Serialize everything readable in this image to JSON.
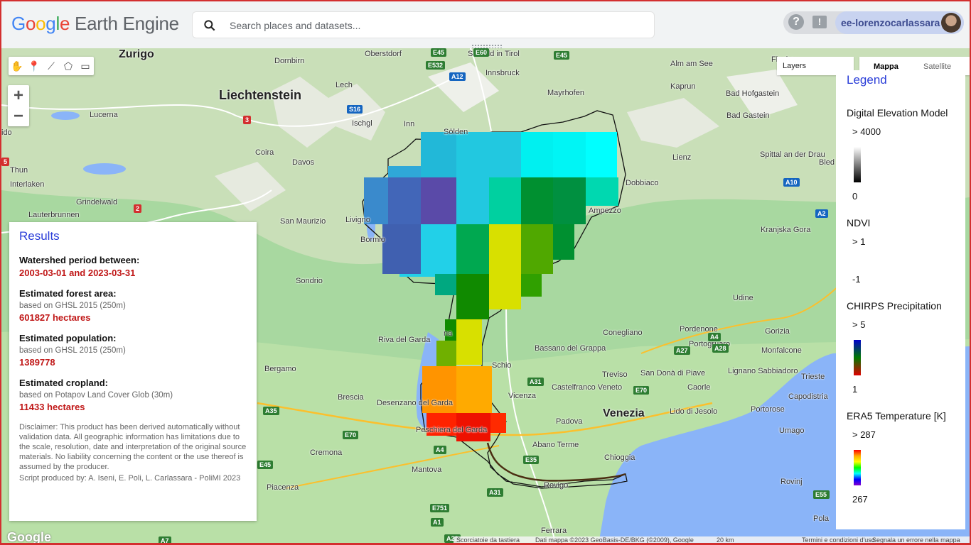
{
  "header": {
    "logo_letters": [
      "G",
      "o",
      "o",
      "g",
      "l",
      "e"
    ],
    "logo_suffix": " Earth Engine",
    "search_placeholder": "Search places and datasets...",
    "user": "ee-lorenzocarlassara",
    "help_icon": "?",
    "feedback_icon": "!"
  },
  "map_controls": {
    "layers_label": "Layers",
    "map_type_map": "Mappa",
    "map_type_satellite": "Satellite",
    "zoom_in": "+",
    "zoom_out": "−"
  },
  "results": {
    "title": "Results",
    "watershed_label": "Watershed period between:",
    "watershed_value": "2003-03-01 and 2023-03-31",
    "forest_label": "Estimated forest area:",
    "forest_source": "based on GHSL 2015 (250m)",
    "forest_value": "601827 hectares",
    "population_label": "Estimated population:",
    "population_source": "based on GHSL 2015 (250m)",
    "population_value": "1389778",
    "cropland_label": "Estimated cropland:",
    "cropland_source": "based on Potapov Land Cover Glob (30m)",
    "cropland_value": "11433 hectares",
    "disclaimer": "Disclaimer: This product has been derived automatically without validation data. All geographic information has limitations due to the scale, resolution, date and interpretation of the original source materials. No liability concerning the content or the use thereof is assumed by the producer.",
    "credit": "Script produced by: A. Iseni, E. Poli, L. Carlassara - PoliMI 2023"
  },
  "legend": {
    "title": "Legend",
    "items": [
      {
        "title": "Digital Elevation Model",
        "max": "> 4000",
        "min": "0",
        "colors": [
          "#ffffff",
          "#000000"
        ]
      },
      {
        "title": "NDVI",
        "max": "> 1",
        "min": "-1",
        "colors": [
          "#ffffff",
          "#ffffff"
        ]
      },
      {
        "title": "CHIRPS Precipitation",
        "max": "> 5",
        "min": "1",
        "colors": [
          "#0000cc",
          "#007a00",
          "#e00000"
        ]
      },
      {
        "title": "ERA5 Temperature [K]",
        "max": "> 287",
        "min": "267",
        "colors": [
          "#ff0000",
          "#ffaa00",
          "#ffff00",
          "#00ff00",
          "#00ffff",
          "#0000ff",
          "#8800cc"
        ]
      }
    ]
  },
  "map_labels": [
    {
      "text": "Zurigo",
      "cls": "med"
    },
    {
      "text": "Liechtenstein",
      "cls": "big"
    },
    {
      "text": "Lucerna",
      "cls": ""
    },
    {
      "text": "Coira",
      "cls": ""
    },
    {
      "text": "Davos",
      "cls": ""
    },
    {
      "text": "Thun",
      "cls": ""
    },
    {
      "text": "Interlaken",
      "cls": ""
    },
    {
      "text": "Grindelwald",
      "cls": ""
    },
    {
      "text": "Lauterbrunnen",
      "cls": ""
    },
    {
      "text": "Oberstdorf",
      "cls": ""
    },
    {
      "text": "Dornbirn",
      "cls": ""
    },
    {
      "text": "Lech",
      "cls": ""
    },
    {
      "text": "Seefeld in Tirol",
      "cls": ""
    },
    {
      "text": "Innsbruck",
      "cls": ""
    },
    {
      "text": "Mayrhofen",
      "cls": ""
    },
    {
      "text": "Ischgl",
      "cls": ""
    },
    {
      "text": "Sölden",
      "cls": ""
    },
    {
      "text": "Inn",
      "cls": ""
    },
    {
      "text": "Alm am See",
      "cls": ""
    },
    {
      "text": "Flachau",
      "cls": ""
    },
    {
      "text": "Kaprun",
      "cls": ""
    },
    {
      "text": "Bad Hofgastein",
      "cls": ""
    },
    {
      "text": "Bad Gastein",
      "cls": ""
    },
    {
      "text": "Lienz",
      "cls": ""
    },
    {
      "text": "Spittal an der Drau",
      "cls": ""
    },
    {
      "text": "Bled",
      "cls": ""
    },
    {
      "text": "Kranjska Gora",
      "cls": ""
    },
    {
      "text": "Ampezzo",
      "cls": ""
    },
    {
      "text": "Livigno",
      "cls": ""
    },
    {
      "text": "Bormio",
      "cls": ""
    },
    {
      "text": "San Maurizio",
      "cls": ""
    },
    {
      "text": "Sondrio",
      "cls": ""
    },
    {
      "text": "Riva del Garda",
      "cls": ""
    },
    {
      "text": "Udine",
      "cls": ""
    },
    {
      "text": "Gorizia",
      "cls": ""
    },
    {
      "text": "Conegliano",
      "cls": ""
    },
    {
      "text": "Pordenone",
      "cls": ""
    },
    {
      "text": "Portogruaro",
      "cls": ""
    },
    {
      "text": "Monfalcone",
      "cls": ""
    },
    {
      "text": "Bassano del Grappa",
      "cls": ""
    },
    {
      "text": "Lignano Sabbiadoro",
      "cls": ""
    },
    {
      "text": "Schio",
      "cls": ""
    },
    {
      "text": "Treviso",
      "cls": ""
    },
    {
      "text": "San Donà di Piave",
      "cls": ""
    },
    {
      "text": "Caorle",
      "cls": ""
    },
    {
      "text": "Trieste",
      "cls": ""
    },
    {
      "text": "Capodistria",
      "cls": ""
    },
    {
      "text": "Bergamo",
      "cls": ""
    },
    {
      "text": "Brescia",
      "cls": ""
    },
    {
      "text": "Desenzano del Garda",
      "cls": ""
    },
    {
      "text": "Vicenza",
      "cls": ""
    },
    {
      "text": "Castelfranco Veneto",
      "cls": ""
    },
    {
      "text": "Venezia",
      "cls": "med"
    },
    {
      "text": "Lido di Jesolo",
      "cls": ""
    },
    {
      "text": "Portorose",
      "cls": ""
    },
    {
      "text": "Umago",
      "cls": ""
    },
    {
      "text": "Padova",
      "cls": ""
    },
    {
      "text": "Peschiera del Garda",
      "cls": ""
    },
    {
      "text": "Abano Terme",
      "cls": ""
    },
    {
      "text": "Cremona",
      "cls": ""
    },
    {
      "text": "Mantova",
      "cls": ""
    },
    {
      "text": "Chioggia",
      "cls": ""
    },
    {
      "text": "Piacenza",
      "cls": ""
    },
    {
      "text": "Rovigo",
      "cls": ""
    },
    {
      "text": "Ferrara",
      "cls": ""
    },
    {
      "text": "Rovinj",
      "cls": ""
    },
    {
      "text": "Pola",
      "cls": ""
    },
    {
      "text": "Dobbiaco",
      "cls": ""
    },
    {
      "text": "ido",
      "cls": ""
    },
    {
      "text": "na",
      "cls": ""
    },
    {
      "text": "Re",
      "cls": ""
    }
  ],
  "road_shields": [
    {
      "text": "E45",
      "cls": ""
    },
    {
      "text": "E532",
      "cls": ""
    },
    {
      "text": "A12",
      "cls": "blue"
    },
    {
      "text": "S16",
      "cls": "blue"
    },
    {
      "text": "E60",
      "cls": ""
    },
    {
      "text": "E45",
      "cls": ""
    },
    {
      "text": "3",
      "cls": "red"
    },
    {
      "text": "2",
      "cls": "red"
    },
    {
      "text": "5",
      "cls": "red"
    },
    {
      "text": "A10",
      "cls": "blue"
    },
    {
      "text": "A2",
      "cls": "blue"
    },
    {
      "text": "A4",
      "cls": ""
    },
    {
      "text": "A27",
      "cls": ""
    },
    {
      "text": "A31",
      "cls": ""
    },
    {
      "text": "E70",
      "cls": ""
    },
    {
      "text": "A35",
      "cls": ""
    },
    {
      "text": "E70",
      "cls": ""
    },
    {
      "text": "A4",
      "cls": ""
    },
    {
      "text": "E45",
      "cls": ""
    },
    {
      "text": "E35",
      "cls": ""
    },
    {
      "text": "A31",
      "cls": ""
    },
    {
      "text": "A13",
      "cls": ""
    },
    {
      "text": "E55",
      "cls": ""
    },
    {
      "text": "E751",
      "cls": ""
    },
    {
      "text": "A22",
      "cls": ""
    },
    {
      "text": "A7",
      "cls": ""
    },
    {
      "text": "A1",
      "cls": ""
    },
    {
      "text": "E70",
      "cls": ""
    },
    {
      "text": "A28",
      "cls": ""
    },
    {
      "text": "A23",
      "cls": ""
    }
  ],
  "attribution": {
    "google": "Google",
    "shortcuts": "Scorciatoie da tastiera",
    "data": "Dati mappa ©2023 GeoBasis-DE/BKG (©2009), Google",
    "scale": "20 km",
    "terms": "Termini e condizioni d'uso",
    "report": "Segnala un errore nella mappa"
  },
  "colors": {
    "accent": "#2a3dd8",
    "value_red": "#c01717",
    "frame_red": "#d32f2f"
  }
}
